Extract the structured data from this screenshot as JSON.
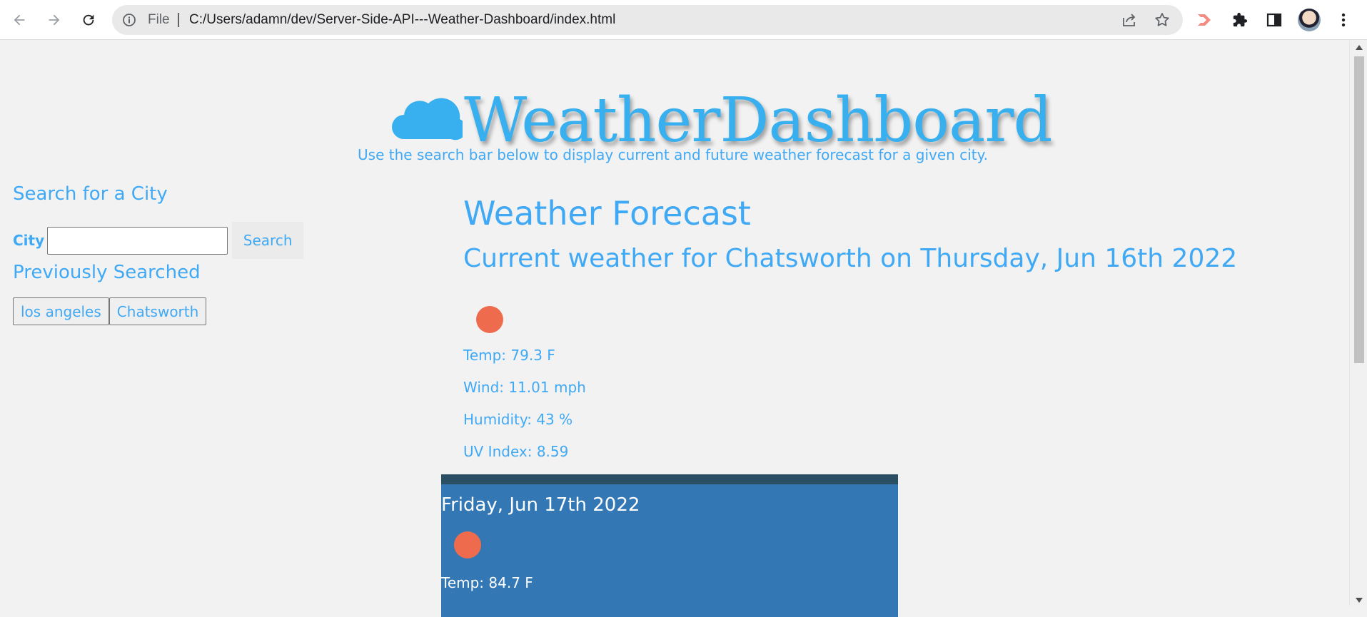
{
  "browser": {
    "scheme": "File",
    "url": "C:/Users/adamn/dev/Server-Side-API---Weather-Dashboard/index.html"
  },
  "header": {
    "brand": "WeatherDashboard",
    "subtitle": "Use the search bar below to display current and future weather forecast for a given city."
  },
  "sidebar": {
    "search_heading": "Search for a City",
    "city_label": "City",
    "city_value": "",
    "search_button": "Search",
    "previous_heading": "Previously Searched",
    "history": [
      "los angeles",
      "Chatsworth"
    ]
  },
  "main": {
    "heading": "Weather Forecast",
    "current_title": "Current weather for Chatsworth on Thursday, Jun 16th 2022",
    "current_icon": "sun-icon",
    "temp": "Temp: 79.3 F",
    "wind": "Wind: 11.01 mph",
    "humidity": "Humidity: 43 %",
    "uv": "UV Index: 8.59"
  },
  "forecast": [
    {
      "date": "Friday, Jun 17th 2022",
      "icon": "sun-icon",
      "temp": "Temp: 84.7 F"
    }
  ],
  "colors": {
    "accent": "#3fa9f5",
    "sun": "#ee6c4d",
    "card": "#3378b5",
    "card_top": "#2a4e64"
  }
}
